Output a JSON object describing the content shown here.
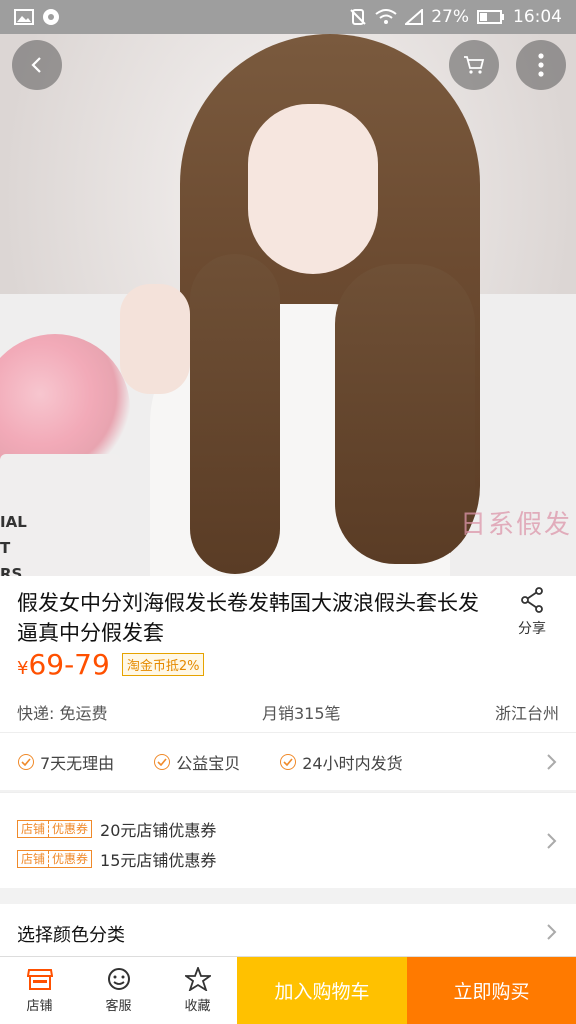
{
  "status_bar": {
    "battery": "27%",
    "time": "16:04"
  },
  "hero": {
    "watermark": "日系假发",
    "sign_text": [
      "IAL",
      "T",
      "RS"
    ],
    "slide_count": 5,
    "active_slide": 1
  },
  "product": {
    "title": "假发女中分刘海假发长卷发韩国大波浪假头套长发逼真中分假发套",
    "share_label": "分享",
    "price_symbol": "¥",
    "price": "69-79",
    "gold_tag": "淘金币抵2%",
    "shipping": "快递: 免运费",
    "monthly_sales": "月销315笔",
    "location": "浙江台州"
  },
  "guarantees": [
    "7天无理由",
    "公益宝贝",
    "24小时内发货"
  ],
  "coupons": {
    "tag_left": "店铺",
    "tag_right": "优惠券",
    "items": [
      "20元店铺优惠券",
      "15元店铺优惠券"
    ]
  },
  "select": {
    "label": "选择颜色分类"
  },
  "bottom_bar": {
    "shop": "店铺",
    "service": "客服",
    "favorite": "收藏",
    "add_cart": "加入购物车",
    "buy_now": "立即购买"
  },
  "colors": {
    "accent": "#ff5000",
    "cart_button": "#ffc100",
    "buy_button": "#ff7a00"
  }
}
